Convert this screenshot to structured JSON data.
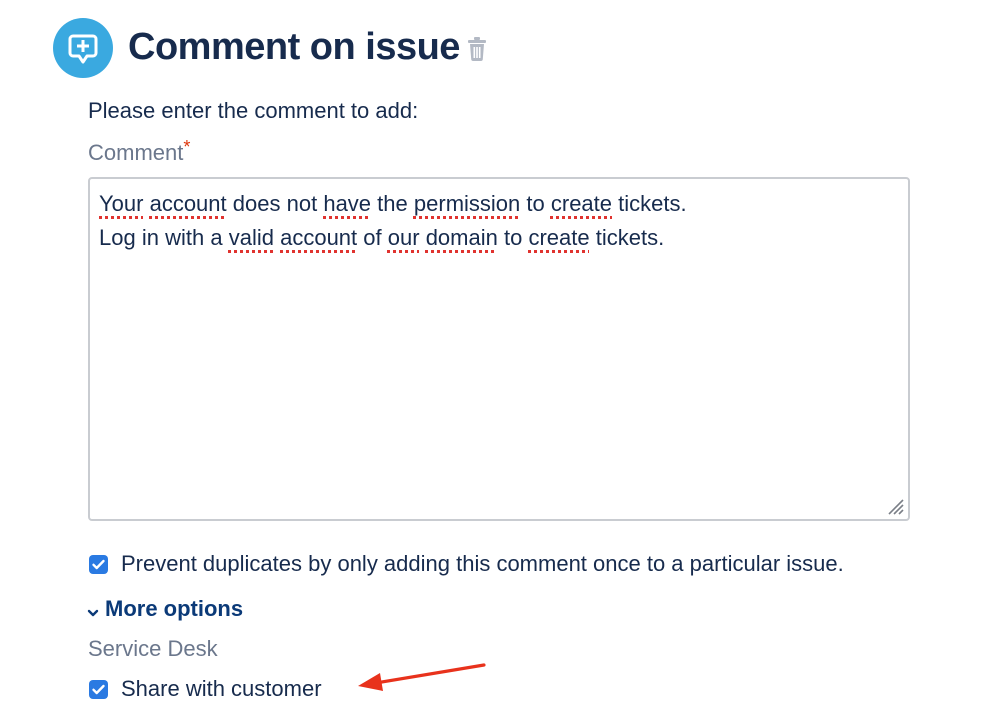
{
  "header": {
    "title": "Comment on issue",
    "icon": "comment-add-icon",
    "icon_color": "#3aa9e0",
    "delete_icon": "trash-icon"
  },
  "form": {
    "instruction": "Please enter the comment to add:",
    "comment_label": "Comment",
    "required_marker": "*",
    "comment_lines": [
      "Your account does not have the permission to create tickets.",
      "Log in with a valid account of our domain to create tickets."
    ],
    "prevent_duplicates": {
      "label": "Prevent duplicates by only adding this comment once to a particular issue.",
      "checked": true
    },
    "more_options_label": "More options",
    "service_desk_label": "Service Desk",
    "share_with_customer": {
      "label": "Share with customer",
      "checked": true
    }
  },
  "colors": {
    "title_text": "#172b4d",
    "label_gray": "#6b778c",
    "checkbox_blue": "#2a7ae2",
    "link_blue": "#0b3a78",
    "required_red": "#de350b",
    "annotation_arrow": "#e8321c"
  },
  "annotation": {
    "arrow": "red-arrow-icon",
    "points_to": "share-with-customer-checkbox"
  }
}
